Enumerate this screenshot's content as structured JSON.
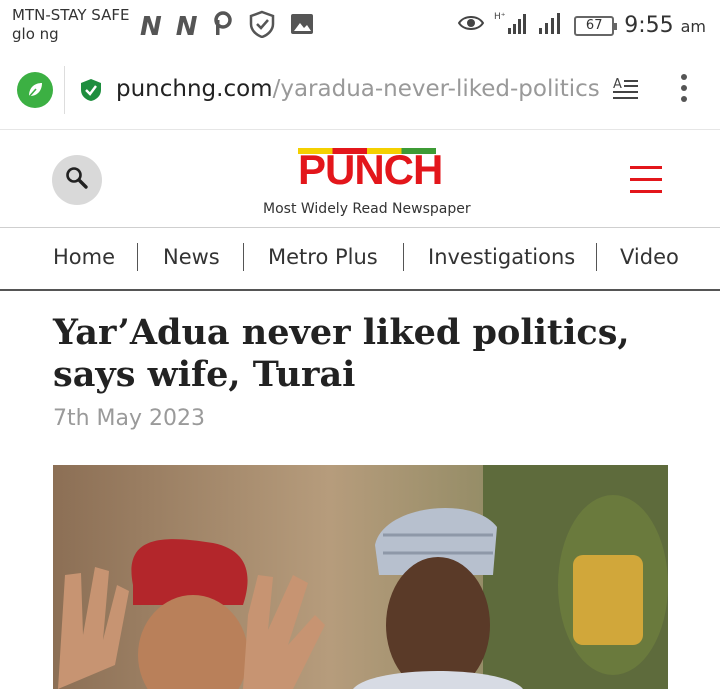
{
  "status_bar": {
    "carrier_line1": "MTN-STAY SAFE",
    "carrier_line2": "glo ng",
    "battery": "67",
    "time": "9:55",
    "ampm": "am"
  },
  "browser": {
    "url_host": "punchng.com",
    "url_path": "/yaradua-never-liked-politics-says"
  },
  "site": {
    "logo_text": "PUNCH",
    "tagline": "Most Widely Read Newspaper",
    "brand_color": "#e3161b"
  },
  "nav": {
    "items": [
      {
        "label": "Home"
      },
      {
        "label": "News"
      },
      {
        "label": "Metro Plus"
      },
      {
        "label": "Investigations"
      },
      {
        "label": "Video"
      }
    ]
  },
  "article": {
    "headline": "Yar’Adua never liked politics, says wife, Turai",
    "date": "7th May 2023"
  }
}
